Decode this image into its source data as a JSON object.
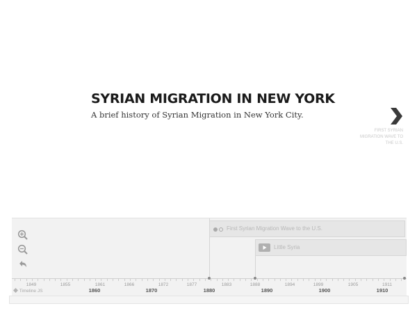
{
  "slide": {
    "title": "SYRIAN MIGRATION IN NEW YORK",
    "subtitle": "A brief history of Syrian Migration in New York City."
  },
  "next_nav": {
    "icon": "chevron-right-icon",
    "label": "FIRST SYRIAN MIGRATION WAVE TO THE U.S."
  },
  "timenav": {
    "controls": [
      {
        "name": "zoom-in-icon"
      },
      {
        "name": "zoom-out-icon"
      },
      {
        "name": "back-arrow-icon"
      }
    ],
    "markers": [
      {
        "title": "First Syrian Migration Wave to the U.S.",
        "media_icon": "text-dots-icon"
      },
      {
        "title": "Little Syria",
        "media_icon": "video-play-icon"
      }
    ],
    "minor_labels": [
      "1849",
      "1855",
      "1861",
      "1866",
      "1872",
      "1877",
      "1883",
      "1888",
      "1894",
      "1899",
      "1905",
      "1911"
    ],
    "major_labels": [
      "1860",
      "1870",
      "1880",
      "1890",
      "1900",
      "1910"
    ],
    "brand": "Timeline JS"
  },
  "colors": {
    "title": "#1a1a1a",
    "timenav_bg": "#f2f2f2",
    "marker_bg": "#e6e6e6",
    "muted_text": "#b8b8b8"
  }
}
